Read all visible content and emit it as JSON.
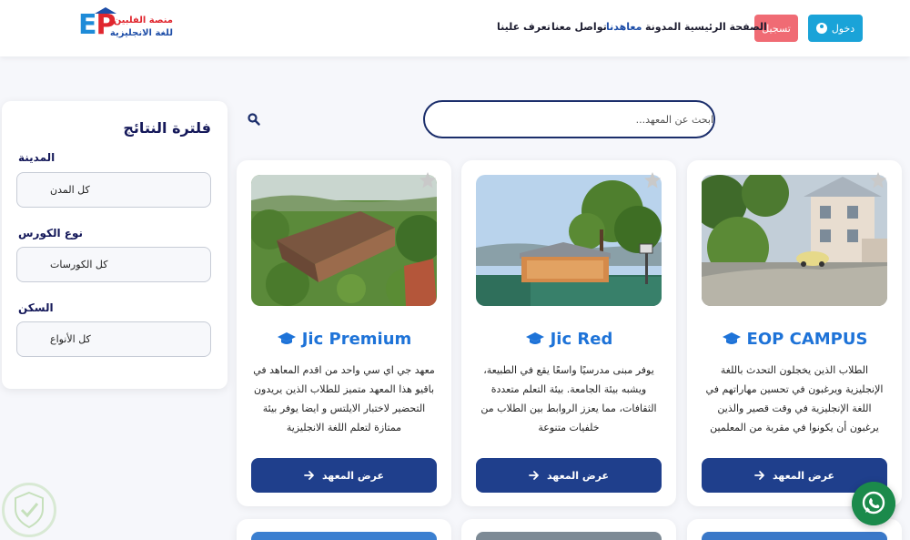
{
  "header": {
    "logo": {
      "letters": "EP",
      "line1": "منصة الفلبين",
      "line2": "للغة الانجليزية"
    },
    "login_label": "دخول",
    "register_label": "تسجيل",
    "nav": [
      "الصفحة الرئيسية",
      "المدونة",
      "معاهدنا",
      "تواصل معنا",
      "تعرف علينا"
    ],
    "active_nav": "معاهدنا"
  },
  "filter": {
    "title": "فلترة النتائج",
    "city_label": "المدينة",
    "city_value": "كل المدن",
    "course_label": "نوع الكورس",
    "course_value": "كل الكورسات",
    "housing_label": "السكن",
    "housing_value": "كل الأنواع"
  },
  "search": {
    "placeholder": "ابحث عن المعهد..."
  },
  "cards": [
    {
      "title": "EOP CAMPUS",
      "desc": "الطلاب الذين يخجلون التحدث باللغة الإنجليزية ويرغبون في تحسين مهاراتهم في اللغة الإنجليزية في وقت قصير والذين يرغبون أن يكونوا في مقربة من المعلمين",
      "button": "عرض المعهد"
    },
    {
      "title": "Jic Red",
      "desc": "يوفر مبنى مدرسيًا واسعًا يقع في الطبيعة، ويشبه بيئة الجامعة. بيئة التعلم متعددة الثقافات، مما يعزز الروابط بين الطلاب من خلفيات متنوعة",
      "button": "عرض المعهد"
    },
    {
      "title": "Jic Premium",
      "desc": "معهد جي اي سي واحد من اقدم المعاهد في باقيو هذا المعهد متميز للطلاب الذين يريدون التحضير لاختبار الايلتس و ايضا يوفر بيئة ممتازة لتعلم اللغة الانجليزية",
      "button": "عرض المعهد"
    }
  ],
  "colors": {
    "accent": "#1e73d8",
    "button": "#1f3f8c",
    "login": "#1aa3d8",
    "register": "#f06b74",
    "whatsapp": "#1b8a4b"
  },
  "icons": [
    "user-icon",
    "search-icon",
    "star-icon",
    "graduation-cap-icon",
    "arrow-right-icon",
    "whatsapp-icon"
  ]
}
